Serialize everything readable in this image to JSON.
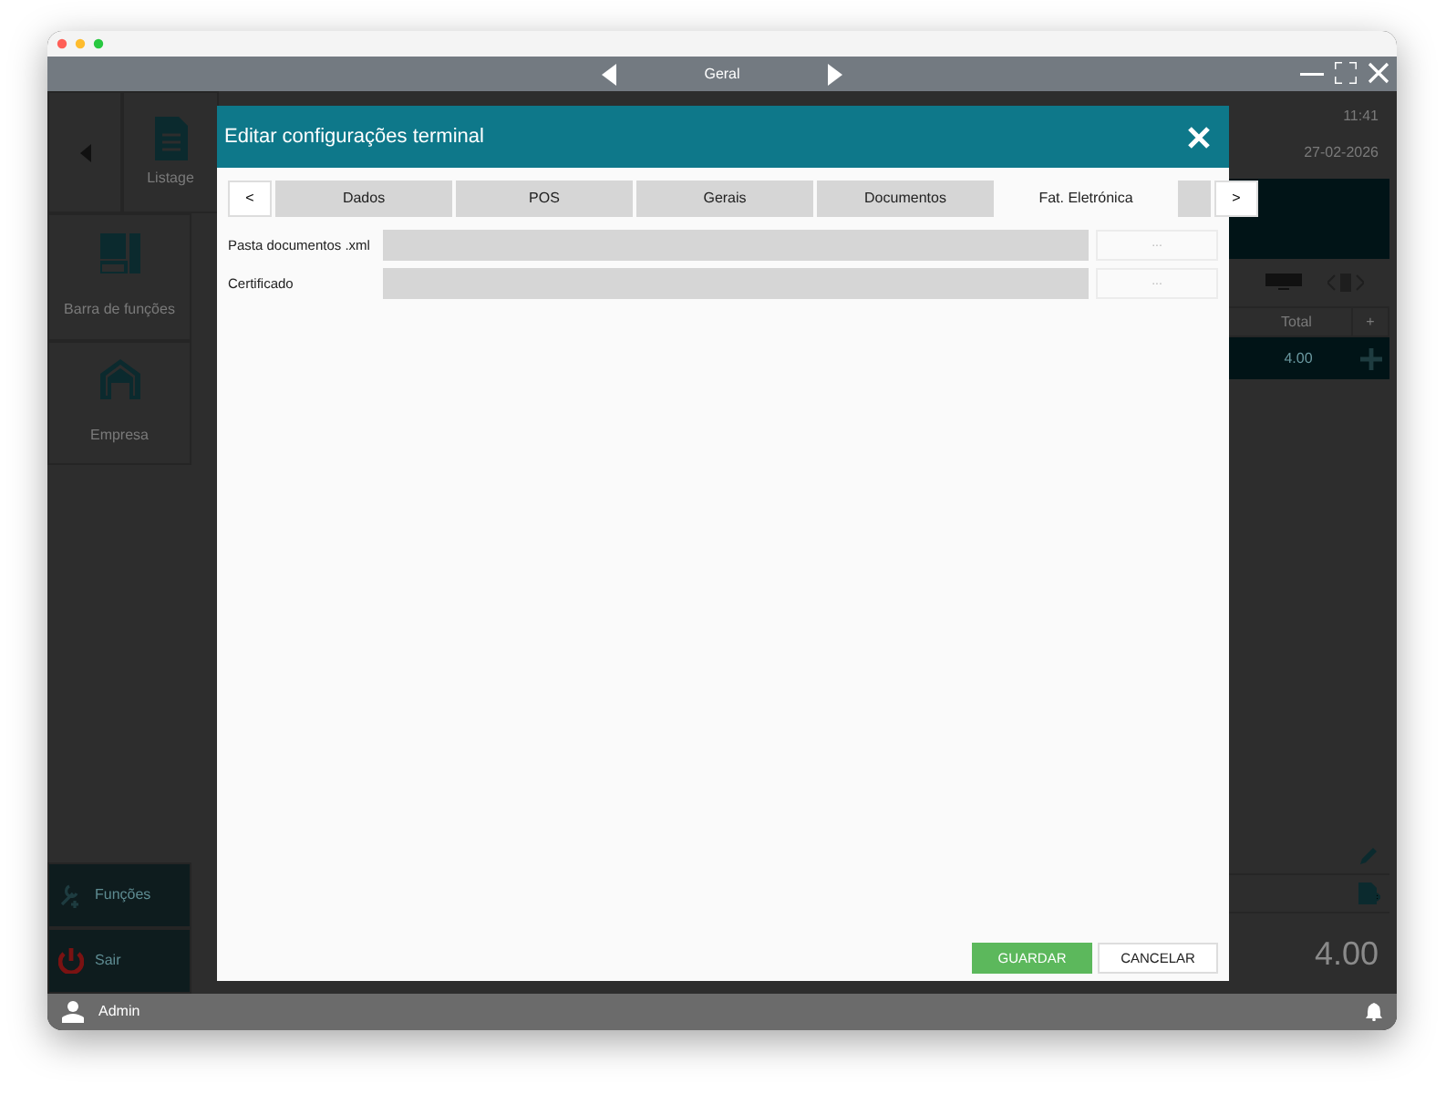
{
  "app_bar": {
    "title": "Geral"
  },
  "background": {
    "nav_tiles": [
      {
        "label": "Listage"
      },
      {
        "label": "Barra de funções"
      },
      {
        "label": "Empresa"
      }
    ],
    "clock": {
      "time": "11:41",
      "date": "27-02-2026"
    },
    "order": {
      "columns": [
        "Total",
        "+"
      ],
      "row_total": "4.00",
      "grand_total": "4.00"
    },
    "bottom_tiles": [
      {
        "label": "Funções",
        "kind": "tools"
      },
      {
        "label": "Sair",
        "kind": "exit"
      }
    ]
  },
  "dialog": {
    "title": "Editar configurações terminal",
    "scroll_prev": "<",
    "scroll_next": ">",
    "tabs": [
      {
        "label": "Dados",
        "selected": false
      },
      {
        "label": "POS",
        "selected": false
      },
      {
        "label": "Gerais",
        "selected": false
      },
      {
        "label": "Documentos",
        "selected": false
      },
      {
        "label": "Fat. Eletrónica",
        "selected": true
      }
    ],
    "fields": [
      {
        "label": "Pasta documentos .xml",
        "browse": "..."
      },
      {
        "label": "Certificado",
        "browse": "..."
      }
    ],
    "buttons": [
      {
        "label": "GUARDAR",
        "kind": "primary"
      },
      {
        "label": "CANCELAR",
        "kind": "secondary"
      }
    ]
  },
  "status_bar": {
    "user": "Admin"
  }
}
